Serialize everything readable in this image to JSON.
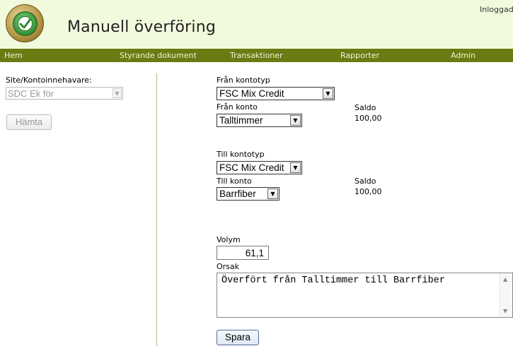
{
  "header": {
    "title": "Manuell överföring",
    "login_text": "Inloggad"
  },
  "nav": {
    "items": [
      "Hem",
      "Styrande dokument",
      "Transaktioner",
      "Rapporter",
      "Admin"
    ]
  },
  "left_panel": {
    "site_label": "Site/Kontoinnehavare:",
    "site_value": "SDC Ek för",
    "fetch_button": "Hämta"
  },
  "from": {
    "account_type_label": "Från kontotyp",
    "account_type_value": "FSC Mix Credit",
    "account_label": "Från konto",
    "account_value": "Talltimmer",
    "balance_label": "Saldo",
    "balance_value": "100,00"
  },
  "to": {
    "account_type_label": "Till kontotyp",
    "account_type_value": "FSC Mix Credit",
    "account_label": "Till konto",
    "account_value": "Barrfiber",
    "balance_label": "Saldo",
    "balance_value": "100,00"
  },
  "form": {
    "volume_label": "Volym",
    "volume_value": "61,1",
    "reason_label": "Orsak",
    "reason_value": "Överfört från Talltimmer till Barrfiber",
    "save_button": "Spara"
  },
  "icons": {
    "logo": "checkmark-logo-icon",
    "dropdown": "chevron-down-icon",
    "scroll_up": "scroll-up-icon",
    "scroll_down": "scroll-down-icon"
  }
}
